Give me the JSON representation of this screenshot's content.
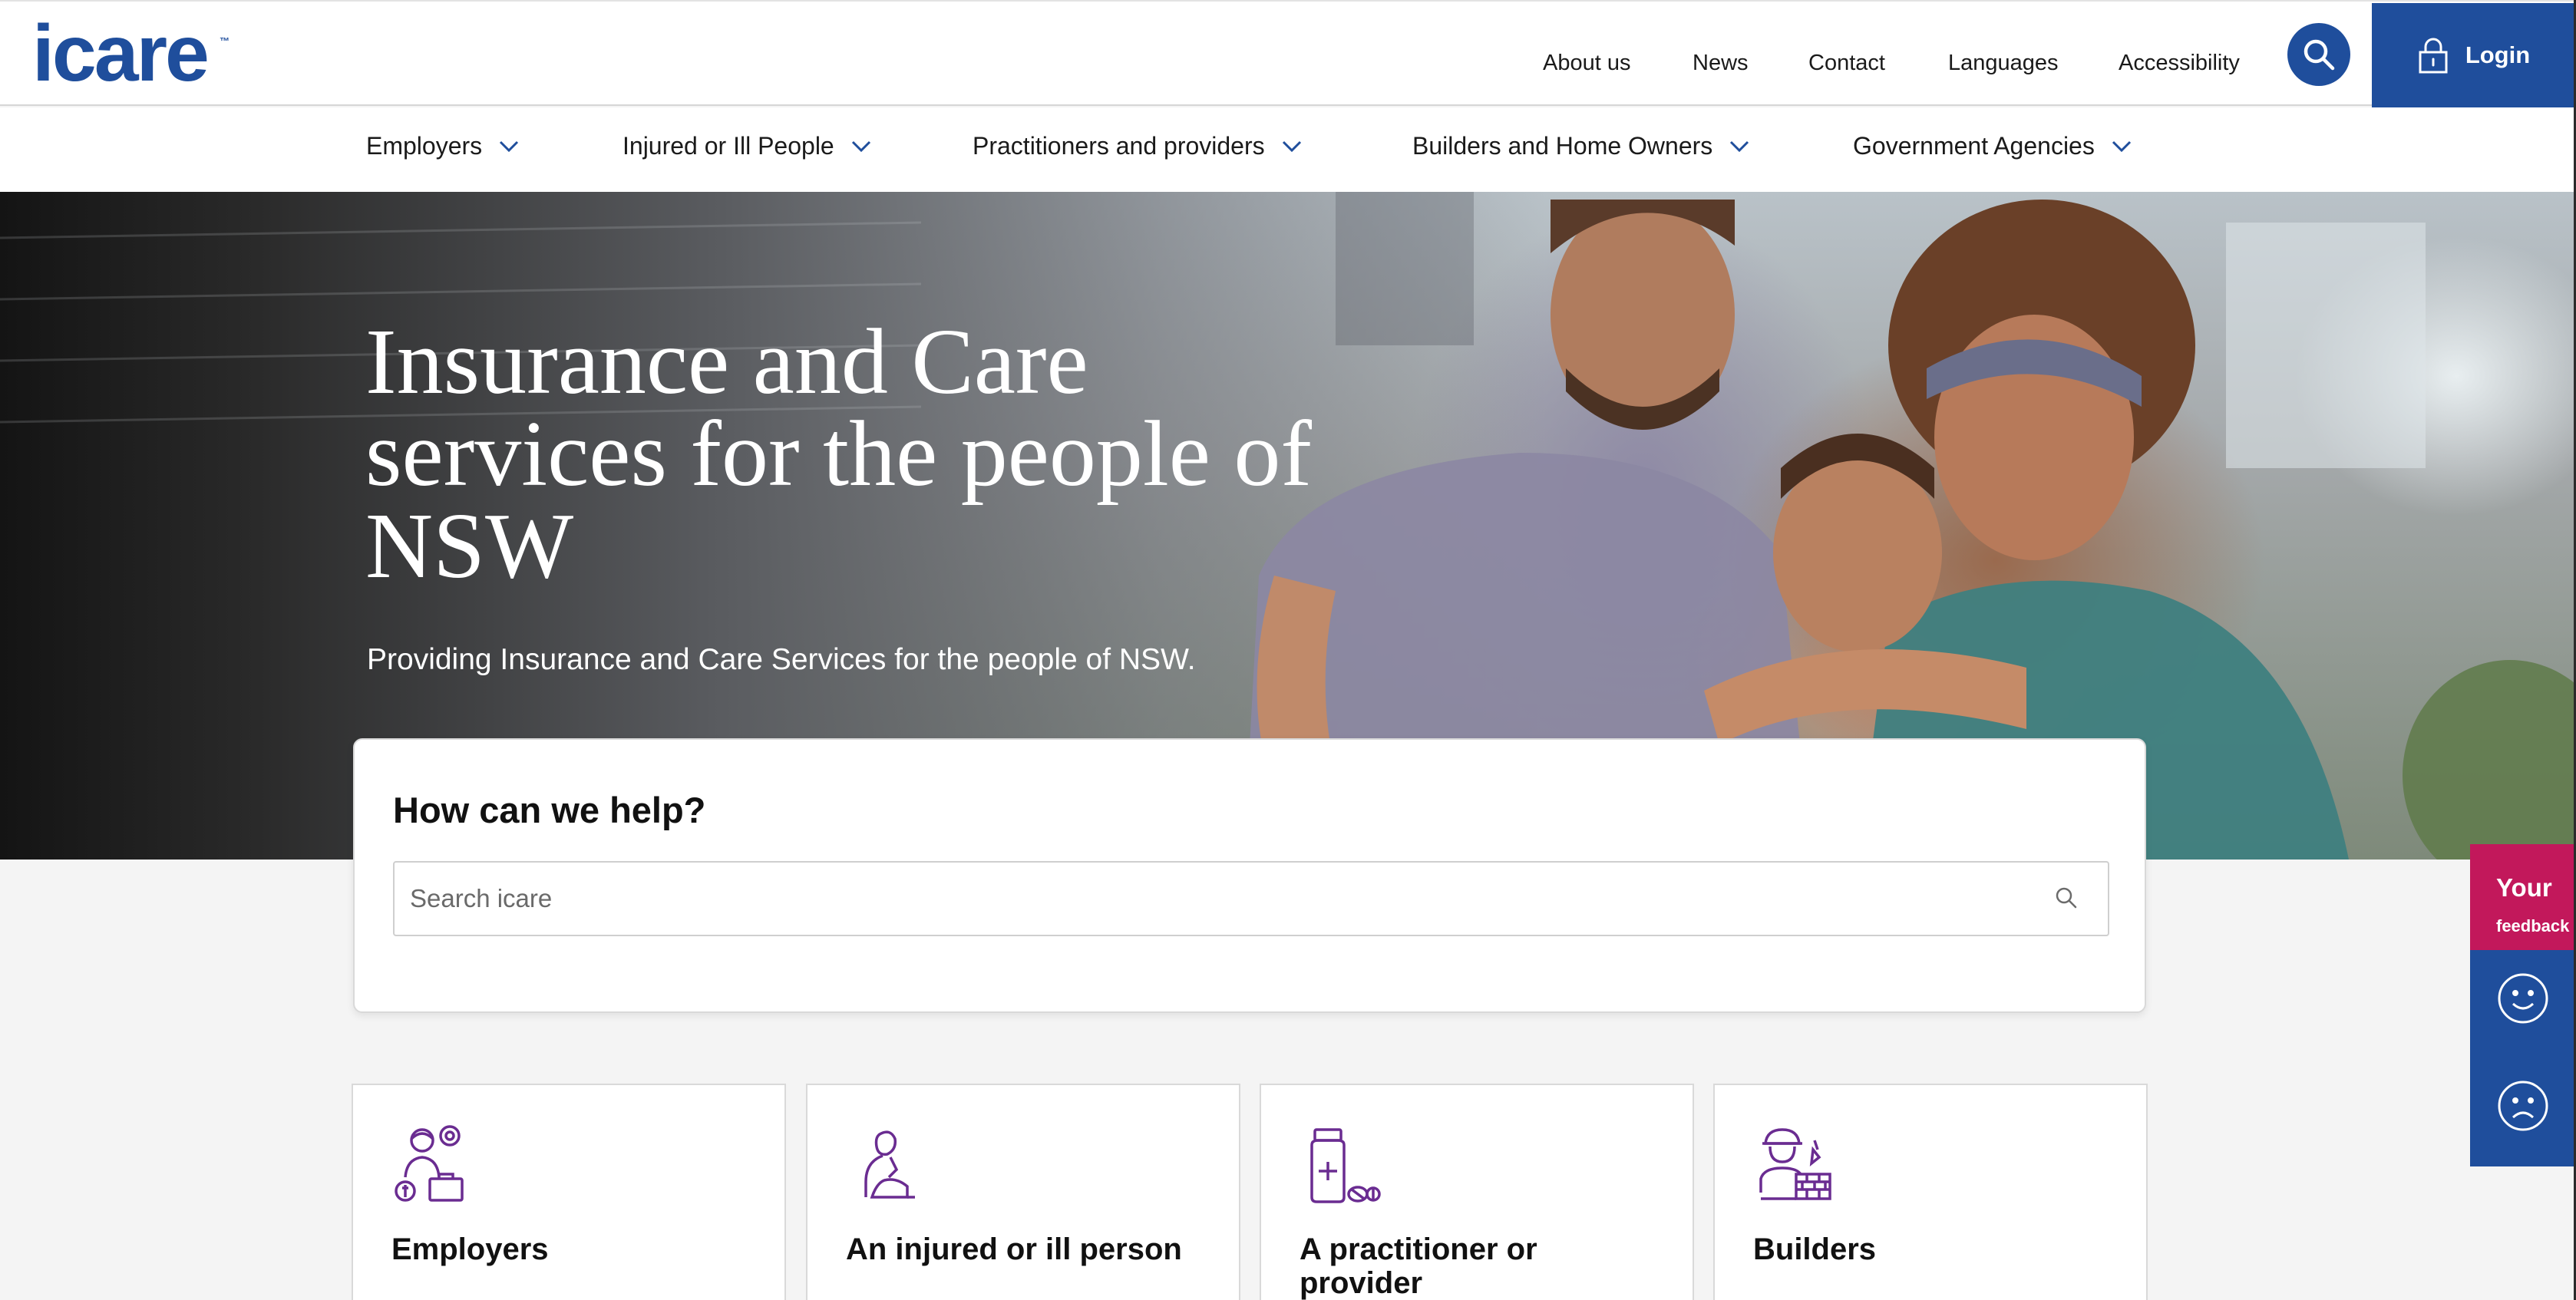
{
  "brand": {
    "logo_text": "icare",
    "trademark": "™",
    "color": "#1f4e9c"
  },
  "utility_nav": {
    "links": [
      "About us",
      "News",
      "Contact",
      "Languages",
      "Accessibility"
    ],
    "login_label": "Login"
  },
  "main_nav": {
    "items": [
      "Employers",
      "Injured or Ill People",
      "Practitioners and providers",
      "Builders and Home Owners",
      "Government Agencies"
    ]
  },
  "hero": {
    "title": "Insurance and Care services for the people of NSW",
    "subtitle": "Providing Insurance and Care Services for the people of NSW."
  },
  "help": {
    "title": "How can we help?",
    "search_placeholder": "Search icare",
    "search_value": ""
  },
  "categories": [
    {
      "label": "Employers",
      "icon": "employer-icon"
    },
    {
      "label": "An injured or ill person",
      "icon": "injured-person-icon"
    },
    {
      "label": "A practitioner or provider",
      "icon": "medicine-bottle-icon"
    },
    {
      "label": "Builders",
      "icon": "builder-icon"
    }
  ],
  "feedback": {
    "your": "Your",
    "feedback": "feedback"
  },
  "colors": {
    "primary_blue": "#1f4e9c",
    "feedback_pink": "#c2185b",
    "icon_purple": "#6a2c91"
  }
}
